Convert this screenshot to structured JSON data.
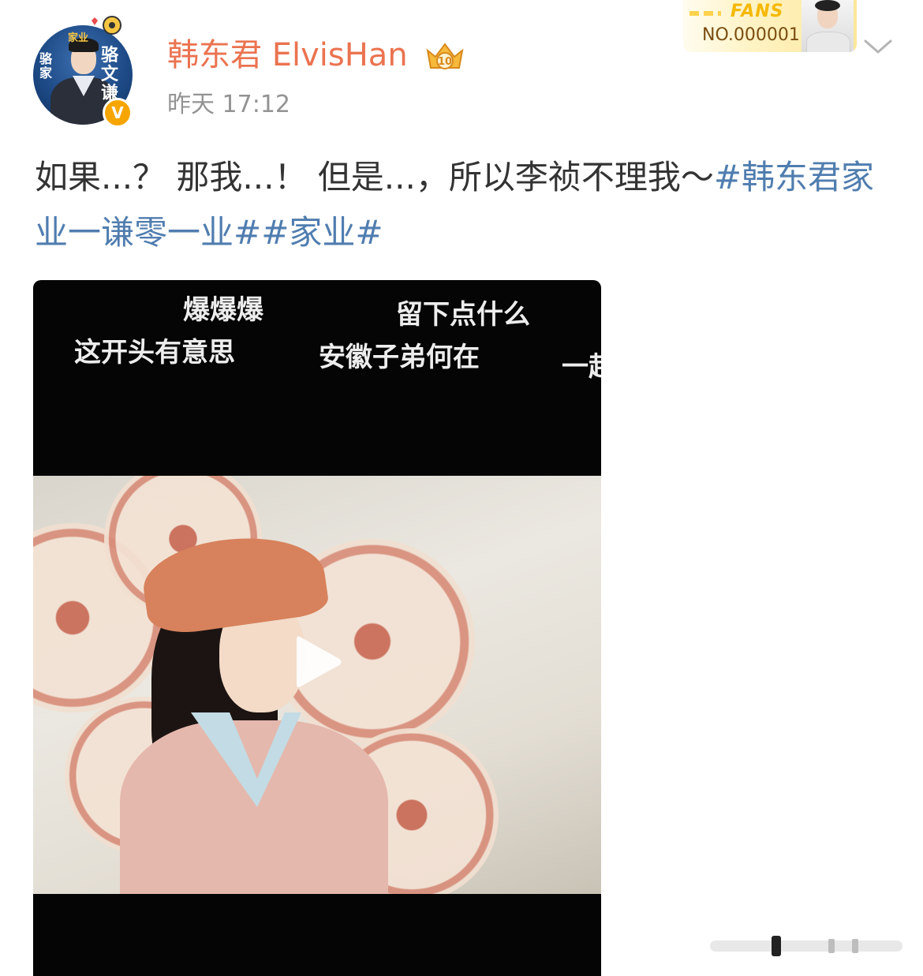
{
  "author": {
    "name": "韩东君 ElvisHan",
    "avatar_text": {
      "top": "家业",
      "left": "骆家",
      "right": "骆文谦"
    },
    "verified_mark": "V",
    "member_icon": "crown-10-icon",
    "timestamp": "昨天 17:12"
  },
  "fans_card": {
    "label": "FANS",
    "number": "NO.000001"
  },
  "post": {
    "text": "如果...？ 那我...！ 但是...，所以李祯不理我～",
    "hashtags": [
      "#韩东君家业一谦零一业#",
      "#家业#"
    ]
  },
  "video": {
    "danmaku": [
      "爆爆爆",
      "留下点什么",
      "这开头有意思",
      "安徽子弟何在",
      "一起"
    ]
  },
  "icons": {
    "play": "play-icon",
    "more": "chevron-down-icon"
  },
  "colors": {
    "username": "#eb7350",
    "hashtag": "#507daf",
    "verified": "#f7a500",
    "timestamp": "#939393"
  }
}
